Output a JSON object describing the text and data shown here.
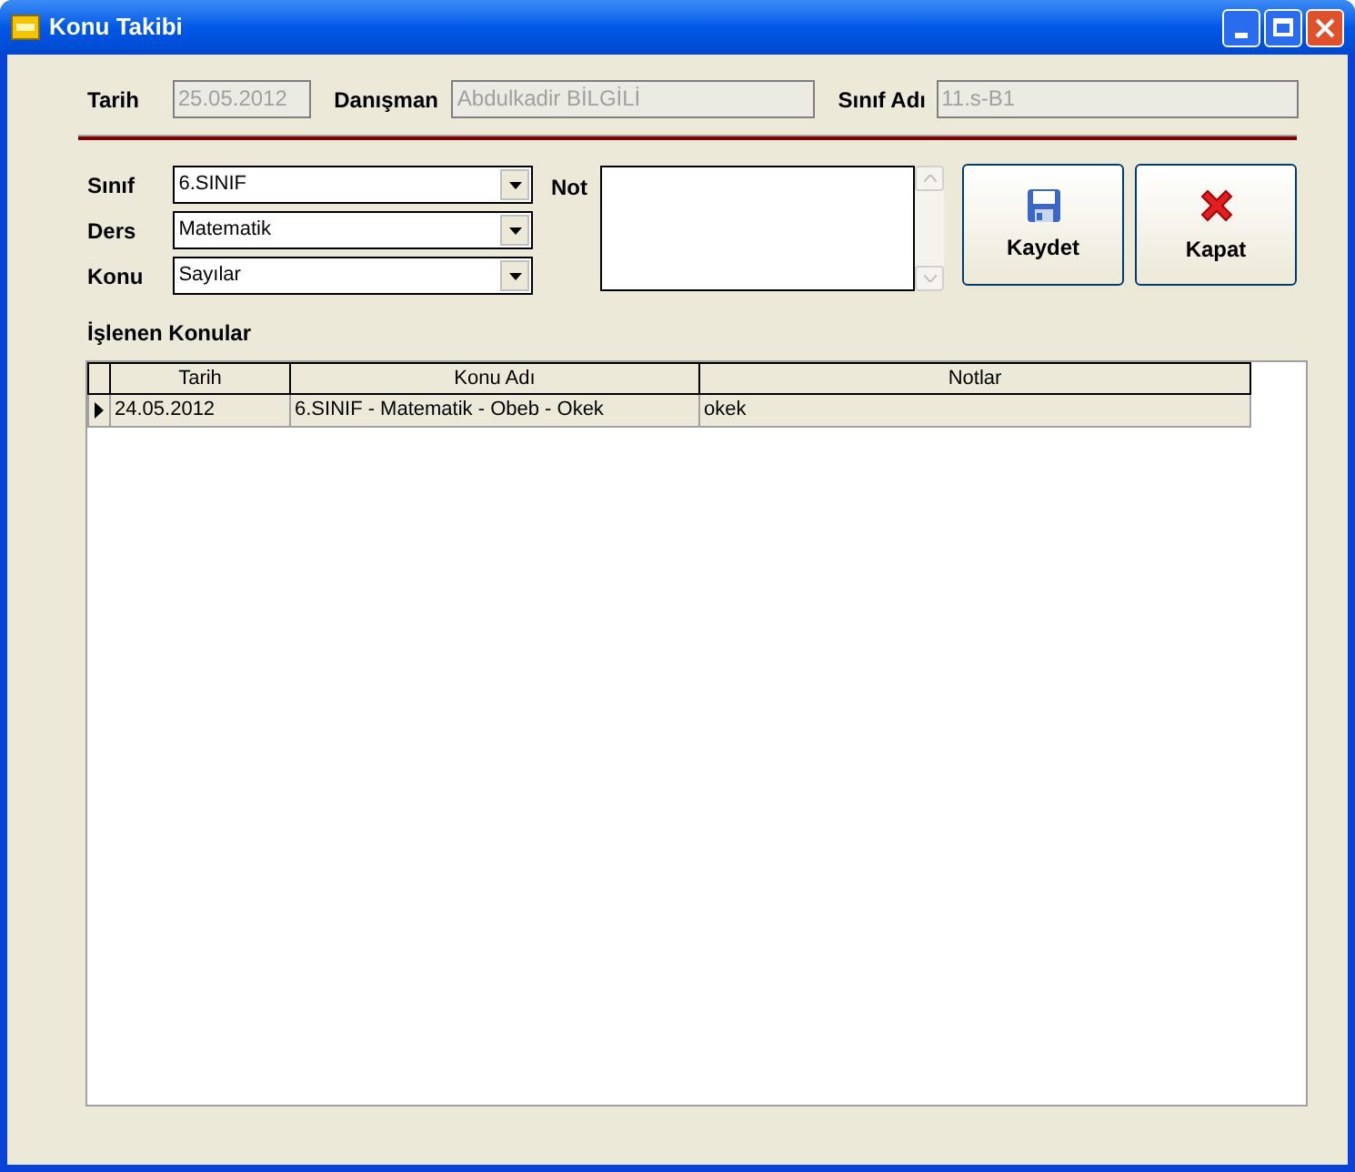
{
  "window": {
    "title": "Konu Takibi"
  },
  "header": {
    "tarih_label": "Tarih",
    "tarih_value": "25.05.2012",
    "danisman_label": "Danışman",
    "danisman_value": "Abdulkadir BİLGİLİ",
    "sinif_adi_label": "Sınıf Adı",
    "sinif_adi_value": "11.s-B1"
  },
  "selectors": [
    {
      "label": "Sınıf",
      "value": "6.SINIF"
    },
    {
      "label": "Ders",
      "value": "Matematik"
    },
    {
      "label": "Konu",
      "value": "Sayılar"
    }
  ],
  "note": {
    "label": "Not"
  },
  "buttons": [
    {
      "kind": "save",
      "label": "Kaydet"
    },
    {
      "kind": "close",
      "label": "Kapat"
    }
  ],
  "table": {
    "title": "İşlenen Konular",
    "columns": [
      "Tarih",
      "Konu Adı",
      "Notlar"
    ],
    "rows": [
      {
        "selected": true,
        "cells": [
          "24.05.2012",
          "6.SINIF - Matematik - Obeb - Okek",
          "okek"
        ]
      }
    ]
  }
}
